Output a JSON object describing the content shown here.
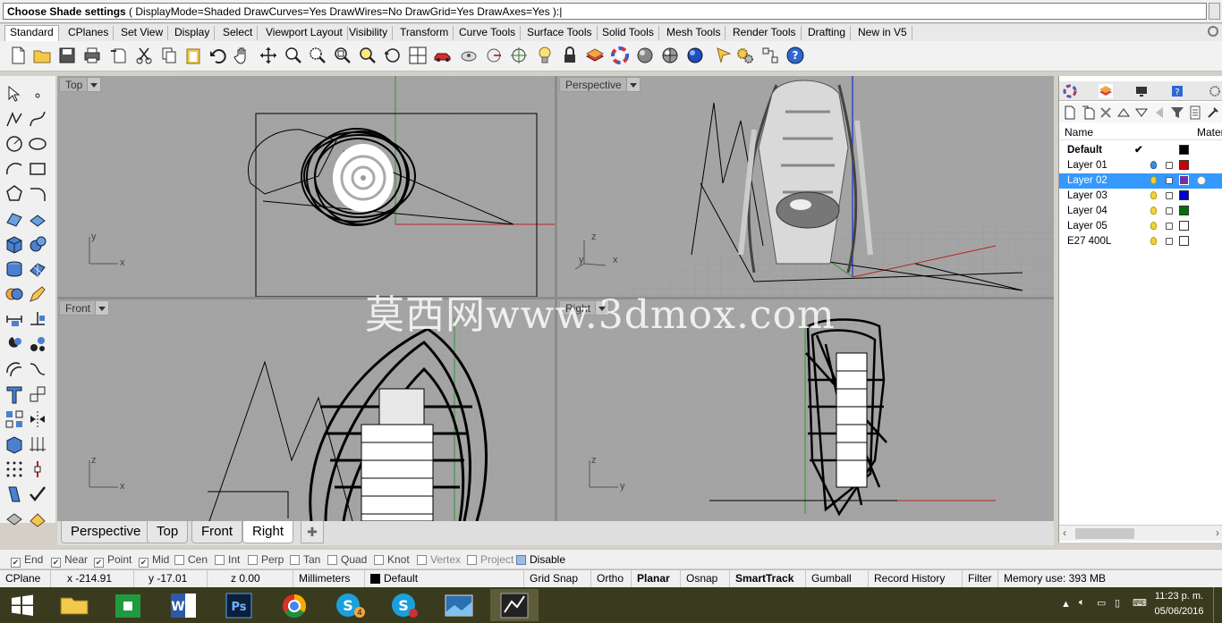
{
  "command": {
    "label": "Choose Shade settings",
    "options_text": " ( DisplayMode=Shaded  DrawCurves=Yes  DrawWires=No  DrawGrid=Yes  DrawAxes=Yes ):"
  },
  "ribbon_tabs": [
    "Standard",
    "CPlanes",
    "Set View",
    "Display",
    "Select",
    "Viewport Layout",
    "Visibility",
    "Transform",
    "Curve Tools",
    "Surface Tools",
    "Solid Tools",
    "Mesh Tools",
    "Render Tools",
    "Drafting",
    "New in V5"
  ],
  "active_tab": "Standard",
  "viewports": {
    "top": {
      "label": "Top",
      "axis_x": "x",
      "axis_y": "y"
    },
    "perspective": {
      "label": "Perspective",
      "axis_x": "x",
      "axis_y": "y",
      "axis_z": "z"
    },
    "front": {
      "label": "Front",
      "axis_x": "x",
      "axis_z": "z"
    },
    "right": {
      "label": "Right",
      "axis_y": "y",
      "axis_z": "z"
    }
  },
  "viewport_tabs": [
    "Perspective",
    "Top",
    "Front",
    "Right"
  ],
  "active_viewport_tab": "Right",
  "watermark": "莫西网www.3dmox.com",
  "layers_panel": {
    "header_name": "Name",
    "header_material": "Mater",
    "current_check": "✔",
    "layers": [
      {
        "name": "Default",
        "color": "#000000",
        "bold": true,
        "current": true
      },
      {
        "name": "Layer 01",
        "color": "#d00000",
        "bulb": "#3b8fd6"
      },
      {
        "name": "Layer 02",
        "color": "#7030a0",
        "selected": true
      },
      {
        "name": "Layer 03",
        "color": "#0000d0"
      },
      {
        "name": "Layer 04",
        "color": "#007000"
      },
      {
        "name": "Layer 05",
        "color": "#ffffff"
      },
      {
        "name": "E27 400L",
        "color": "#ffffff"
      }
    ]
  },
  "osnaps": [
    {
      "label": "End",
      "checked": true
    },
    {
      "label": "Near",
      "checked": true
    },
    {
      "label": "Point",
      "checked": true
    },
    {
      "label": "Mid",
      "checked": true
    },
    {
      "label": "Cen",
      "checked": false
    },
    {
      "label": "Int",
      "checked": false
    },
    {
      "label": "Perp",
      "checked": false
    },
    {
      "label": "Tan",
      "checked": false
    },
    {
      "label": "Quad",
      "checked": false
    },
    {
      "label": "Knot",
      "checked": false
    },
    {
      "label": "Vertex",
      "checked": false
    },
    {
      "label": "Project",
      "checked": false
    },
    {
      "label": "Disable",
      "checked": false
    }
  ],
  "status": {
    "cplane": "CPlane",
    "x": "x -214.91",
    "y": "y -17.01",
    "z": "z 0.00",
    "units": "Millimeters",
    "layer": "Default",
    "grid_snap": "Grid Snap",
    "ortho": "Ortho",
    "planar": "Planar",
    "osnap": "Osnap",
    "smarttrack": "SmartTrack",
    "gumball": "Gumball",
    "record_history": "Record History",
    "filter": "Filter",
    "memory": "Memory use: 393 MB"
  },
  "tray": {
    "time": "11:23 p. m.",
    "date": "05/06/2016",
    "badge": "4"
  }
}
